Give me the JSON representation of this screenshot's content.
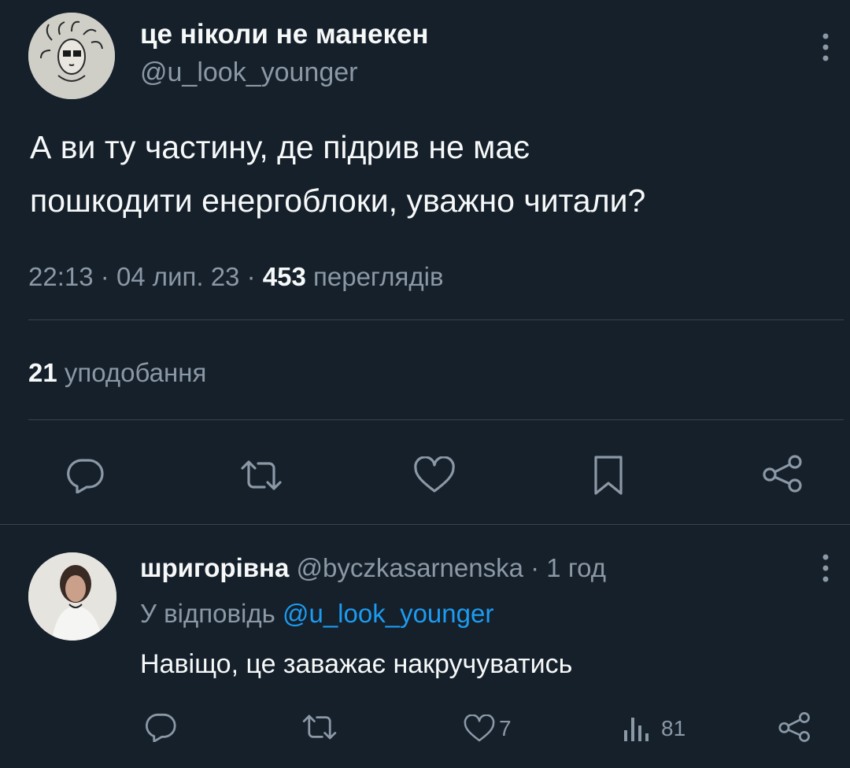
{
  "tweet": {
    "author_name": "це ніколи не манекен",
    "author_handle": "@u_look_younger",
    "text_line1": "А ви ту частину, де підрив не має",
    "text_line2": "пошкодити енергоблоки, уважно читали?",
    "time": "22:13",
    "date": "04 лип. 23",
    "separator": "·",
    "views_count": "453",
    "views_label": "переглядів",
    "likes_count": "21",
    "likes_label": "уподобання"
  },
  "reply": {
    "author_name": "шригорівна",
    "author_handle": "@byczkasarnenska",
    "time_ago": "· 1 год",
    "replying_to_prefix": "У відповідь",
    "replying_to_handle": "@u_look_younger",
    "text": "Навіщо, це заважає накручуватись",
    "like_count": "7",
    "views_count": "81"
  },
  "icons": {
    "more": "more-vertical-icon",
    "reply": "reply-icon",
    "retweet": "retweet-icon",
    "like": "heart-icon",
    "bookmark": "bookmark-icon",
    "share": "share-icon",
    "views": "views-icon"
  },
  "colors": {
    "background": "#15202b",
    "text": "#f7f9f9",
    "muted": "#8b98a5",
    "divider": "#38444d",
    "link": "#1d9bf0"
  }
}
